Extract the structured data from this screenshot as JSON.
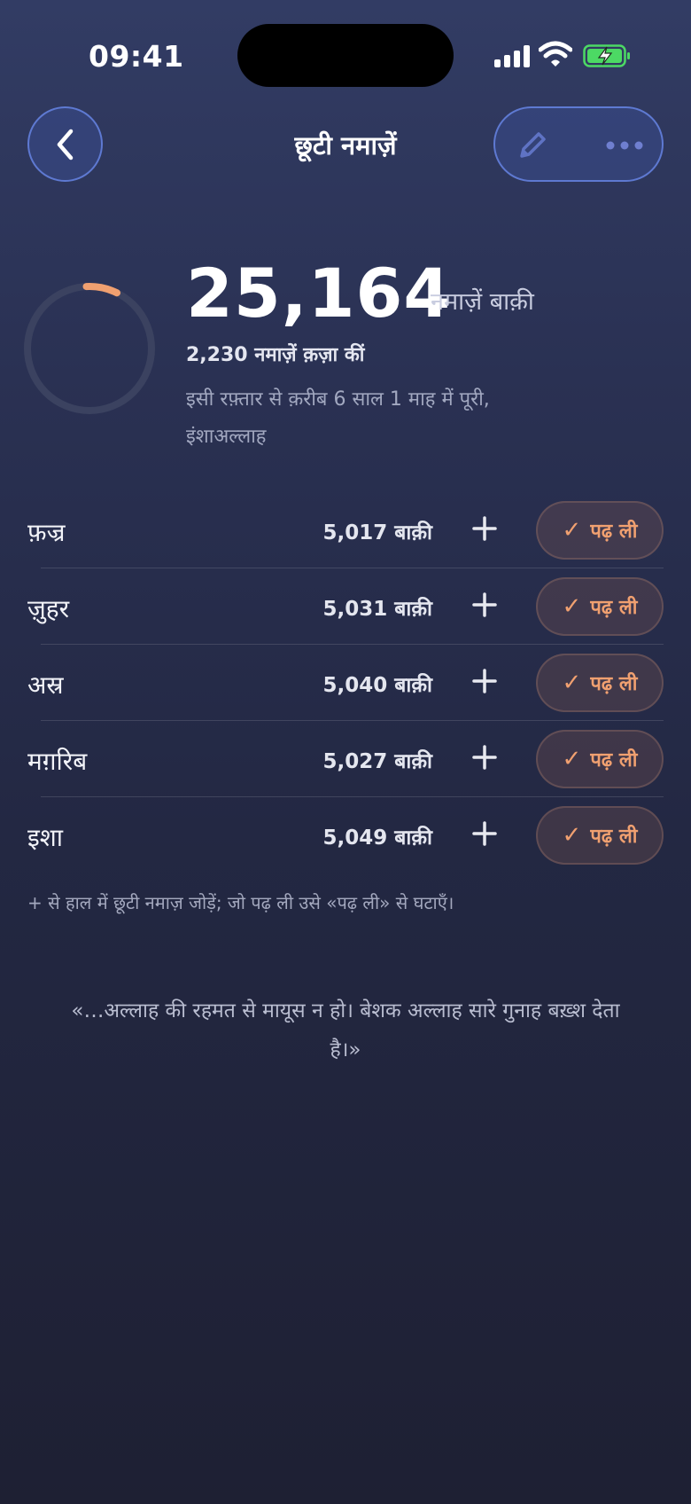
{
  "status_bar": {
    "time": "09:41"
  },
  "header": {
    "title": "छूटी नमाज़ें"
  },
  "summary": {
    "total_remaining": "25,164",
    "total_label": "नमाज़ें बाक़ी",
    "completed_line": "2,230 नमाज़ें क़ज़ा कीं",
    "eta": "इसी रफ़्तार से क़रीब 6 साल 1 माह में पूरी, इंशाअल्लाह",
    "progress_fraction": 0.081
  },
  "prayers": [
    {
      "name": "फ़ज्र",
      "remaining": "5,017 बाक़ी",
      "done_label": "पढ़ ली"
    },
    {
      "name": "ज़ुहर",
      "remaining": "5,031 बाक़ी",
      "done_label": "पढ़ ली"
    },
    {
      "name": "अस्र",
      "remaining": "5,040 बाक़ी",
      "done_label": "पढ़ ली"
    },
    {
      "name": "मग़रिब",
      "remaining": "5,027 बाक़ी",
      "done_label": "पढ़ ली"
    },
    {
      "name": "इशा",
      "remaining": "5,049 बाक़ी",
      "done_label": "पढ़ ली"
    }
  ],
  "hint": "+ से हाल में छूटी नमाज़ जोड़ें; जो पढ़ ली उसे «पढ़ ली» से घटाएँ।",
  "quote": "«…अल्लाह की रहमत से मायूस न हो। बेशक अल्लाह सारे गुनाह बख़्श देता है।»",
  "colors": {
    "accent": "#f0a070",
    "ring_track": "#3b4260",
    "pill_border": "#6e8cf0"
  }
}
